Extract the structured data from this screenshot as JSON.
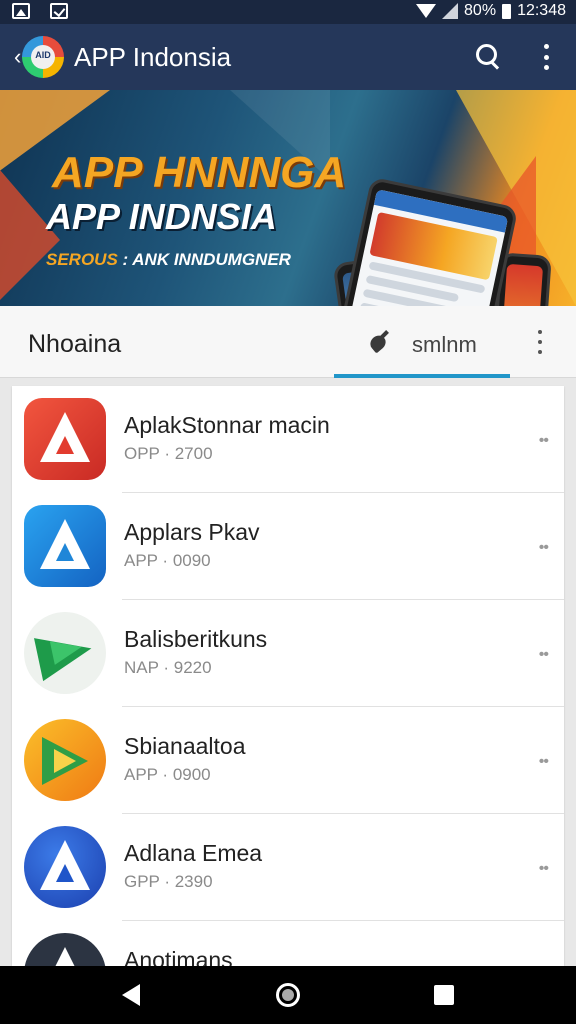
{
  "status_bar": {
    "battery": "80%",
    "time": "12:348"
  },
  "app_bar": {
    "logo_text": "AID",
    "title": "APP Indonsia"
  },
  "banner": {
    "headline": "APP HNNNGA",
    "subtitle": "APP INDNSIA",
    "tagline_prefix": "SEROUS",
    "tagline_rest": ": ANK INNDUMGNER"
  },
  "tabs": {
    "left_label": "Nhoaina",
    "right_label": "smlnm"
  },
  "apps": [
    {
      "title": "AplakStonnar macin",
      "subtitle": "OPP · 2700",
      "icon": "a-logo-red-icon"
    },
    {
      "title": "Applars Pkav",
      "subtitle": "APP · 0090",
      "icon": "a-logo-blue-icon"
    },
    {
      "title": "Balisberitkuns",
      "subtitle": "NAP · 9220",
      "icon": "green-arrow-icon"
    },
    {
      "title": "Sbianaaltoa",
      "subtitle": "APP · 0900",
      "icon": "play-triangle-icon"
    },
    {
      "title": "Adlana Emea",
      "subtitle": "GPP · 2390",
      "icon": "a-logo-navy-icon"
    },
    {
      "title": "Anotimans",
      "subtitle": "",
      "icon": "a-logo-dark-icon"
    }
  ],
  "colors": {
    "app_bar": "#25375a",
    "tab_indicator": "#2196c9",
    "accent_orange": "#f5a623"
  }
}
